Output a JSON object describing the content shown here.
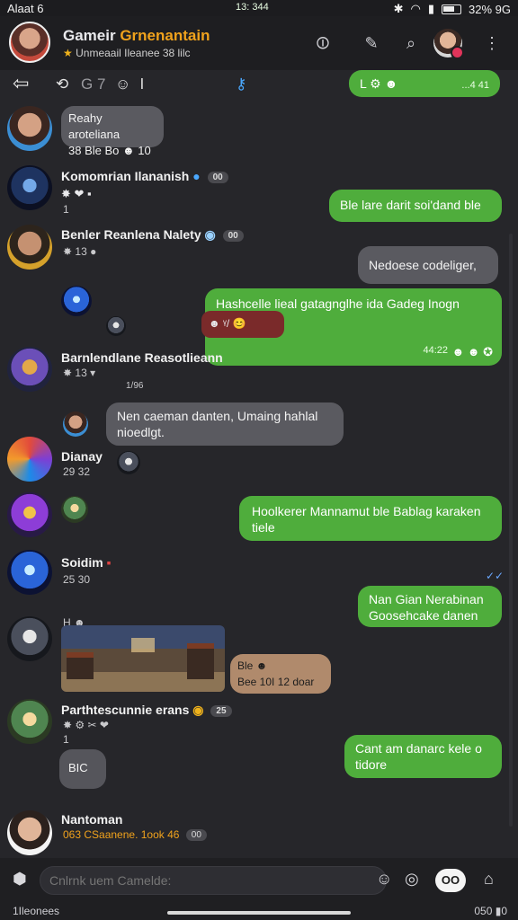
{
  "status": {
    "left": "Alaat 6",
    "time": "13: 344",
    "battery": "32% 9G"
  },
  "header": {
    "title_a": "Gameir",
    "title_b": "Grnenantain",
    "subtitle": "Unmeaail  Ileanee  38  lilc"
  },
  "toolbar": {
    "nav": "⇦",
    "labels": [
      "⟲",
      "G 7",
      "☺",
      "l"
    ]
  },
  "top_out": {
    "text": "L ⚙ ☻",
    "time": "...4  41"
  },
  "messages": [
    {
      "name": "Reahy aroteliana",
      "meta": "38  Ble  Bo"
    },
    {
      "name": "Komomrian Ilananish",
      "meta": "1",
      "pill": "00"
    },
    {
      "name": "Benler Reanlena Nalety",
      "meta": "13",
      "pill": "00"
    },
    {
      "name": "Barnlendlane Reasotlieann",
      "meta": "13",
      "extra": "1/96"
    },
    {
      "name": "Dianay",
      "meta": "29  32"
    },
    {
      "name": "Soidim",
      "meta": "25  30"
    },
    {
      "name": "Parthtescunnie erans",
      "meta": "1",
      "pill": "25"
    },
    {
      "name": "Nantoman",
      "meta": "063  CSaanene.  1ook  46",
      "pill": "00"
    }
  ],
  "in_bubbles": [
    {
      "text": "Reahy aroteliana",
      "sub": "38 Ble Bo ☻ 10"
    },
    {
      "text": "Nen caeman danten, Umaing hahlal nioedlgt."
    },
    {
      "text": "Ble ☻",
      "sub": "Bee 10I 12 doar"
    }
  ],
  "out_bubbles": [
    {
      "text": "Ble lare darit soi'dand ble"
    },
    {
      "text": "Nedoese codeliger,"
    },
    {
      "text": "Hashcelle lieal gatagnglhe ida Gadeg Inogn",
      "time": "44:22"
    },
    {
      "text": "Hoolkerer Mannamut ble Bablag karaken tiele"
    },
    {
      "text": "Nan Gian Nerabinan Goosehcake danen"
    },
    {
      "text": "Cant am danarc kele o tidore"
    }
  ],
  "quote_reply": {
    "text": "☻  ᵞ/ 😊"
  },
  "grey_tag": {
    "text": "BIC"
  },
  "input": {
    "placeholder": "Cnlrnk uem Camelde:",
    "send_label": "OO"
  },
  "bottom": {
    "left": "1Ileonees",
    "right": "050 ▮0"
  },
  "colors": {
    "accent_green": "#4fad3c",
    "bubble_in": "#5a5a60",
    "title_gold": "#f0a21c"
  }
}
